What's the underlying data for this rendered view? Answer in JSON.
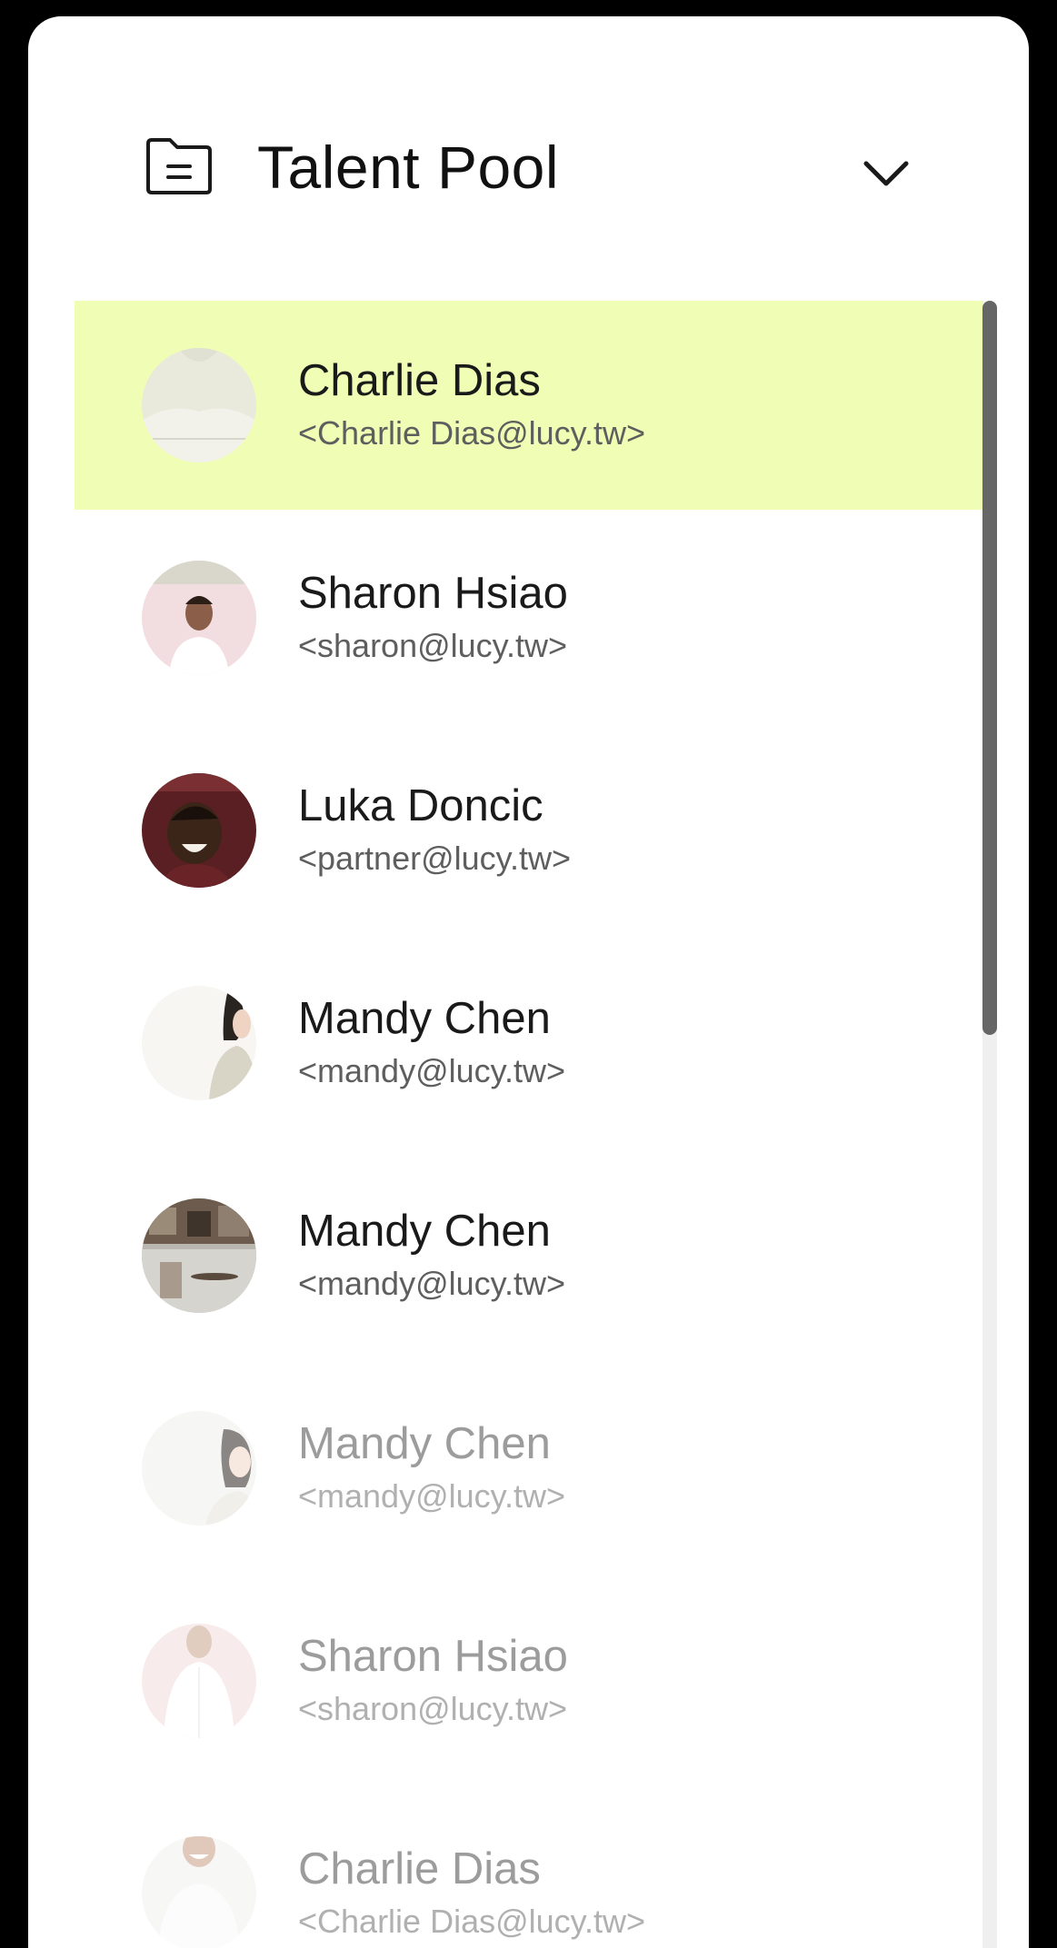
{
  "header": {
    "title": "Talent Pool",
    "icon": "folder-document-icon",
    "toggle_icon": "chevron-down-icon"
  },
  "colors": {
    "selected_background": "#f0fdb5",
    "scrollbar_thumb": "#666666",
    "scrollbar_track": "#efefef"
  },
  "list": {
    "selected_index": 0,
    "items": [
      {
        "name": "Charlie Dias",
        "email": "<Charlie Dias@lucy.tw>",
        "avatar": "avatar-light-shirt"
      },
      {
        "name": "Sharon Hsiao",
        "email": "<sharon@lucy.tw>",
        "avatar": "avatar-man-pink-bg"
      },
      {
        "name": "Luka Doncic",
        "email": "<partner@lucy.tw>",
        "avatar": "avatar-man-laughing"
      },
      {
        "name": "Mandy Chen",
        "email": "<mandy@lucy.tw>",
        "avatar": "avatar-woman-cardigan"
      },
      {
        "name": "Mandy Chen",
        "email": "<mandy@lucy.tw>",
        "avatar": "avatar-room-interior"
      },
      {
        "name": "Mandy Chen",
        "email": "<mandy@lucy.tw>",
        "avatar": "avatar-woman-white-bg"
      },
      {
        "name": "Sharon Hsiao",
        "email": "<sharon@lucy.tw>",
        "avatar": "avatar-man-white-shirt"
      },
      {
        "name": "Charlie Dias",
        "email": "<Charlie Dias@lucy.tw>",
        "avatar": "avatar-man-smiling"
      }
    ]
  },
  "scrollbar": {
    "position_fraction": 0.0,
    "visible_fraction": 0.43
  }
}
